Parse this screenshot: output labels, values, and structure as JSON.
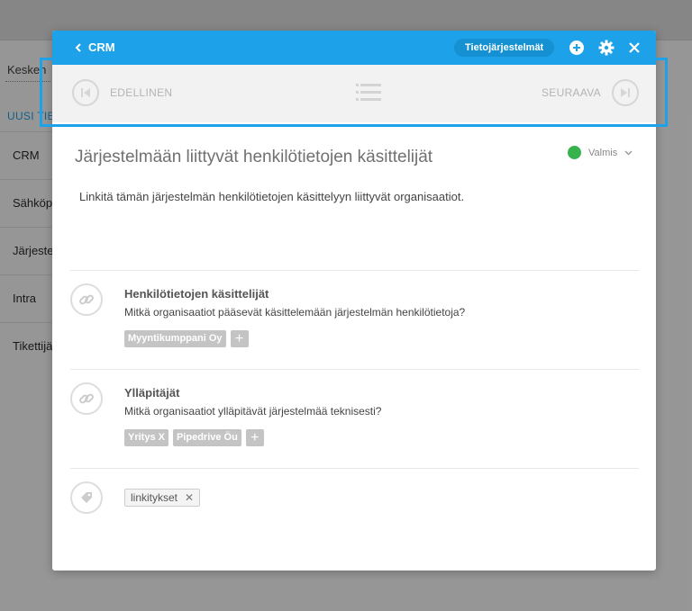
{
  "background": {
    "filter_text": "Kesken",
    "new_label": "UUSI TIE",
    "list": [
      "CRM",
      "Sähköp",
      "Järjeste",
      "Intra",
      "Tikettijä"
    ]
  },
  "header": {
    "back_label": "CRM",
    "pill_label": "Tietojärjestelmät",
    "icons": [
      "plus-circle-icon",
      "gear-icon",
      "close-icon"
    ]
  },
  "nav": {
    "prev_label": "EDELLINEN",
    "next_label": "SEURAAVA"
  },
  "content": {
    "title": "Järjestelmään liittyvät henkilötietojen käsittelijät",
    "status": "Valmis",
    "description": "Linkitä tämän järjestelmän henkilötietojen käsittelyyn liittyvät organisaatiot.",
    "sections": [
      {
        "title": "Henkilötietojen käsittelijät",
        "question": "Mitkä organisaatiot pääsevät käsittelemään järjestelmän henkilötietoja?",
        "tags": [
          "Myyntikumppani Oy"
        ]
      },
      {
        "title": "Ylläpitäjät",
        "question": "Mitkä organisaatiot ylläpitävät järjestelmää teknisesti?",
        "tags": [
          "Yritys X",
          "Pipedrive Öu"
        ]
      }
    ],
    "keyword": "linkitykset"
  },
  "colors": {
    "header": "#1da1e8",
    "status_ok": "#37b24d",
    "highlight": "#1da1e8"
  }
}
